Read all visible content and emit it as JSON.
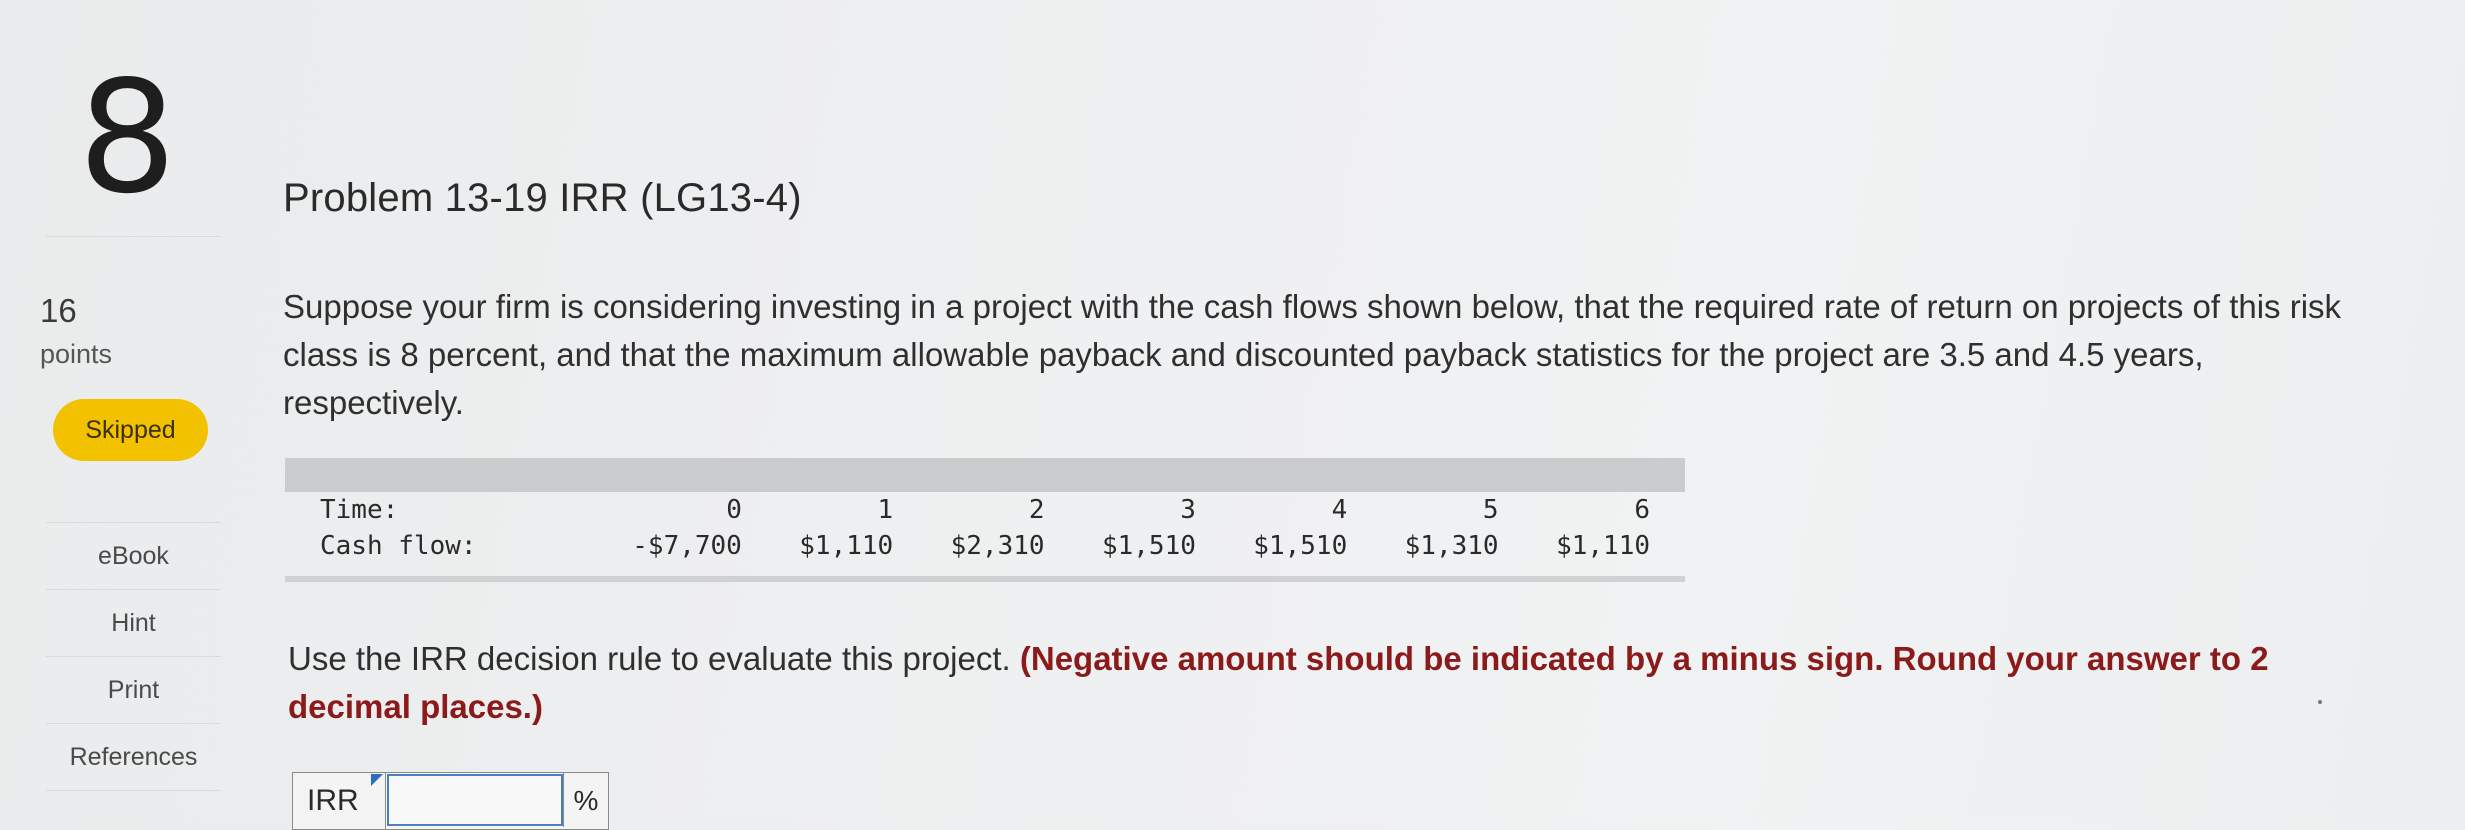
{
  "question": {
    "number": "8",
    "points_value": "16",
    "points_label": "points",
    "status_badge": "Skipped"
  },
  "sidebar": {
    "items": [
      {
        "label": "eBook"
      },
      {
        "label": "Hint"
      },
      {
        "label": "Print"
      },
      {
        "label": "References"
      }
    ]
  },
  "problem": {
    "title": "Problem 13-19 IRR (LG13-4)",
    "text": "Suppose your firm is considering investing in a project with the cash flows shown below, that the required rate of return on projects of this risk class is 8 percent, and that the maximum allowable payback and discounted payback statistics for the project are 3.5 and 4.5 years, respectively."
  },
  "cash_flow_table": {
    "time_label": "Time:",
    "cash_flow_label": "Cash flow:",
    "times": [
      "0",
      "1",
      "2",
      "3",
      "4",
      "5",
      "6"
    ],
    "cash_flows": [
      "-$7,700",
      "$1,110",
      "$2,310",
      "$1,510",
      "$1,510",
      "$1,310",
      "$1,110"
    ]
  },
  "instruction": {
    "text": "Use the IRR decision rule to evaluate this project.",
    "note": "(Negative amount should be indicated by a minus sign. Round your answer to 2 decimal places.)"
  },
  "answer": {
    "label": "IRR",
    "value": "",
    "unit": "%"
  },
  "colors": {
    "badge": "#f2c200",
    "note": "#8b1b1b",
    "input_focus": "#4b7fc0"
  }
}
